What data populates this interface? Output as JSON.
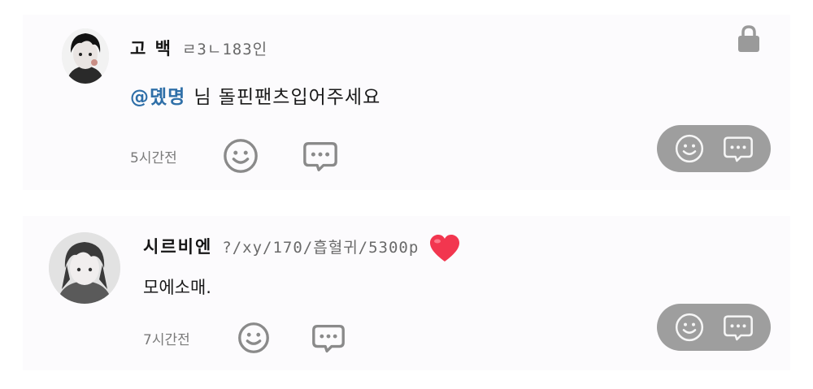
{
  "colors": {
    "card_background": "#fcfbfd",
    "mention": "#2f6fa8",
    "pill_background": "#9e9e9e",
    "heart": "#f2364f",
    "icon_gray": "#7a7a7a"
  },
  "comments": [
    {
      "username": "고 백",
      "profile_tag": "ㄹ3ㄴ183인",
      "mention": "@뎼명",
      "text": "님 돌핀팬츠입어주세요",
      "time": "5시간전",
      "locked": true,
      "icons": [
        "smile-icon",
        "chat-bubble-icon",
        "lock-icon"
      ]
    },
    {
      "username": "시르비엔",
      "profile_tag": "?/xy/170/흡혈귀/5300p",
      "text": "모에소매.",
      "time": "7시간전",
      "badge": "heart-icon",
      "icons": [
        "smile-icon",
        "chat-bubble-icon"
      ]
    }
  ]
}
